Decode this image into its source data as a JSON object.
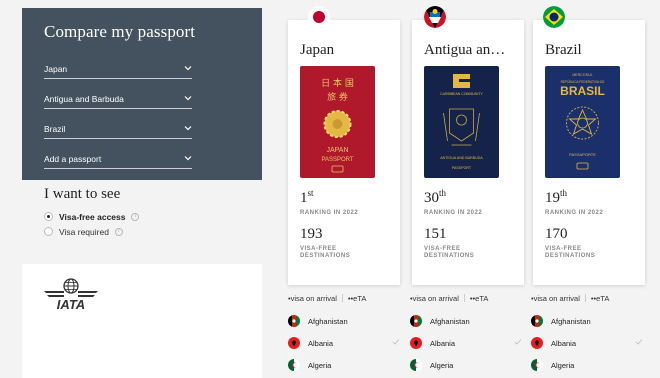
{
  "compare": {
    "title": "Compare my passport",
    "selects": [
      {
        "value": "Japan"
      },
      {
        "value": "Antigua and Barbuda"
      },
      {
        "value": "Brazil"
      },
      {
        "value": "Add a passport"
      }
    ]
  },
  "see": {
    "title": "I want to see",
    "options": [
      {
        "label": "Visa-free access",
        "selected": true
      },
      {
        "label": "Visa required",
        "selected": false
      }
    ]
  },
  "logo": {
    "text": "IATA"
  },
  "rank_label": "RANKING IN 2022",
  "dest_label": "VISA-FREE DESTINATIONS",
  "passports": [
    {
      "name": "Japan",
      "rank": "1",
      "rank_suffix": "st",
      "destinations": "193",
      "cover_lines": [
        "日 本 国",
        "旅 券"
      ],
      "cover_bottom": [
        "JAPAN",
        "PASSPORT"
      ],
      "cover_color": "#b0182c"
    },
    {
      "name": "Antigua an…",
      "rank": "30",
      "rank_suffix": "th",
      "destinations": "151",
      "cover_top": "CARIBBEAN COMMUNITY",
      "cover_bottom": [
        "ANTIGUA AND BARBUDA",
        "PASSPORT"
      ],
      "cover_color": "#15234a"
    },
    {
      "name": "Brazil",
      "rank": "19",
      "rank_suffix": "th",
      "destinations": "170",
      "cover_top": "MERCOSUL",
      "cover_sub": "REPÚBLICA FEDERATIVA DO",
      "cover_main": "BRASIL",
      "cover_bottom": [
        "PASSAPORTE"
      ],
      "cover_color": "#1b2f6b"
    }
  ],
  "legend": {
    "arrival": "•visa on arrival",
    "eta": "••eTA"
  },
  "countries": [
    "Afghanistan",
    "Albania",
    "Algeria"
  ],
  "colors": {
    "panel": "#44525f",
    "background": "#f3f3f3",
    "japan_red": "#bc002d"
  }
}
